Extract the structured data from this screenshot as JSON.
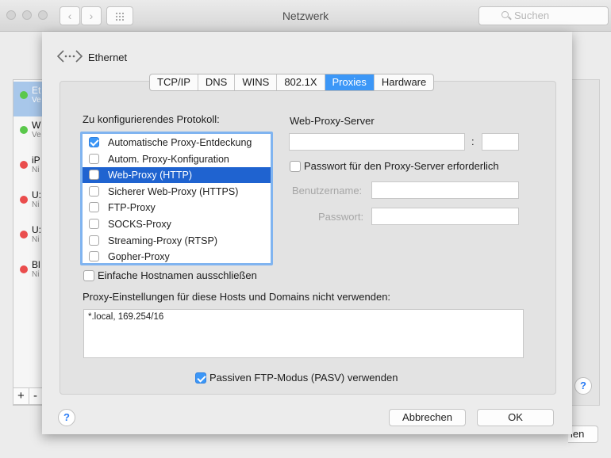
{
  "window": {
    "title": "Netzwerk",
    "search_placeholder": "Suchen"
  },
  "background": {
    "services": [
      {
        "name": "Et",
        "status": "Ve",
        "color": "#5ac84b",
        "selected": true
      },
      {
        "name": "W",
        "status": "Ve",
        "color": "#5ac84b"
      },
      {
        "name": "iP",
        "status": "Ni",
        "color": "#ea4d4d"
      },
      {
        "name": "U:",
        "status": "Ni",
        "color": "#ea4d4d"
      },
      {
        "name": "U:",
        "status": "Ni",
        "color": "#ea4d4d"
      },
      {
        "name": "Bl",
        "status": "Ni",
        "color": "#ea4d4d"
      }
    ],
    "plus": "+",
    "minus": "-",
    "help": "?",
    "right_button_label": "len"
  },
  "sheet": {
    "interface_title": "Ethernet",
    "tabs": [
      {
        "label": "TCP/IP"
      },
      {
        "label": "DNS"
      },
      {
        "label": "WINS"
      },
      {
        "label": "802.1X"
      },
      {
        "label": "Proxies",
        "active": true
      },
      {
        "label": "Hardware"
      }
    ],
    "protocols_heading": "Zu konfigurierendes Protokoll:",
    "protocols": [
      {
        "label": "Automatische Proxy-Entdeckung",
        "checked": true
      },
      {
        "label": "Autom. Proxy-Konfiguration",
        "checked": false
      },
      {
        "label": "Web-Proxy (HTTP)",
        "checked": false,
        "selected": true
      },
      {
        "label": "Sicherer Web-Proxy (HTTPS)",
        "checked": false
      },
      {
        "label": "FTP-Proxy",
        "checked": false
      },
      {
        "label": "SOCKS-Proxy",
        "checked": false
      },
      {
        "label": "Streaming-Proxy (RTSP)",
        "checked": false
      },
      {
        "label": "Gopher-Proxy",
        "checked": false
      }
    ],
    "exclude_simple_hostnames": {
      "label": "Einfache Hostnamen ausschließen",
      "checked": false
    },
    "server": {
      "heading": "Web-Proxy-Server",
      "host_value": "",
      "colon": ":",
      "port_value": "",
      "password_required": {
        "label": "Passwort für den Proxy-Server erforderlich",
        "checked": false
      },
      "username_label": "Benutzername:",
      "username_value": "",
      "password_label": "Passwort:",
      "password_value": ""
    },
    "bypass_heading": "Proxy-Einstellungen für diese Hosts und Domains nicht verwenden:",
    "bypass_value": "*.local, 169.254/16",
    "passive_ftp": {
      "label": "Passiven FTP-Modus (PASV) verwenden",
      "checked": true
    },
    "help": "?",
    "cancel_label": "Abbrechen",
    "ok_label": "OK"
  }
}
